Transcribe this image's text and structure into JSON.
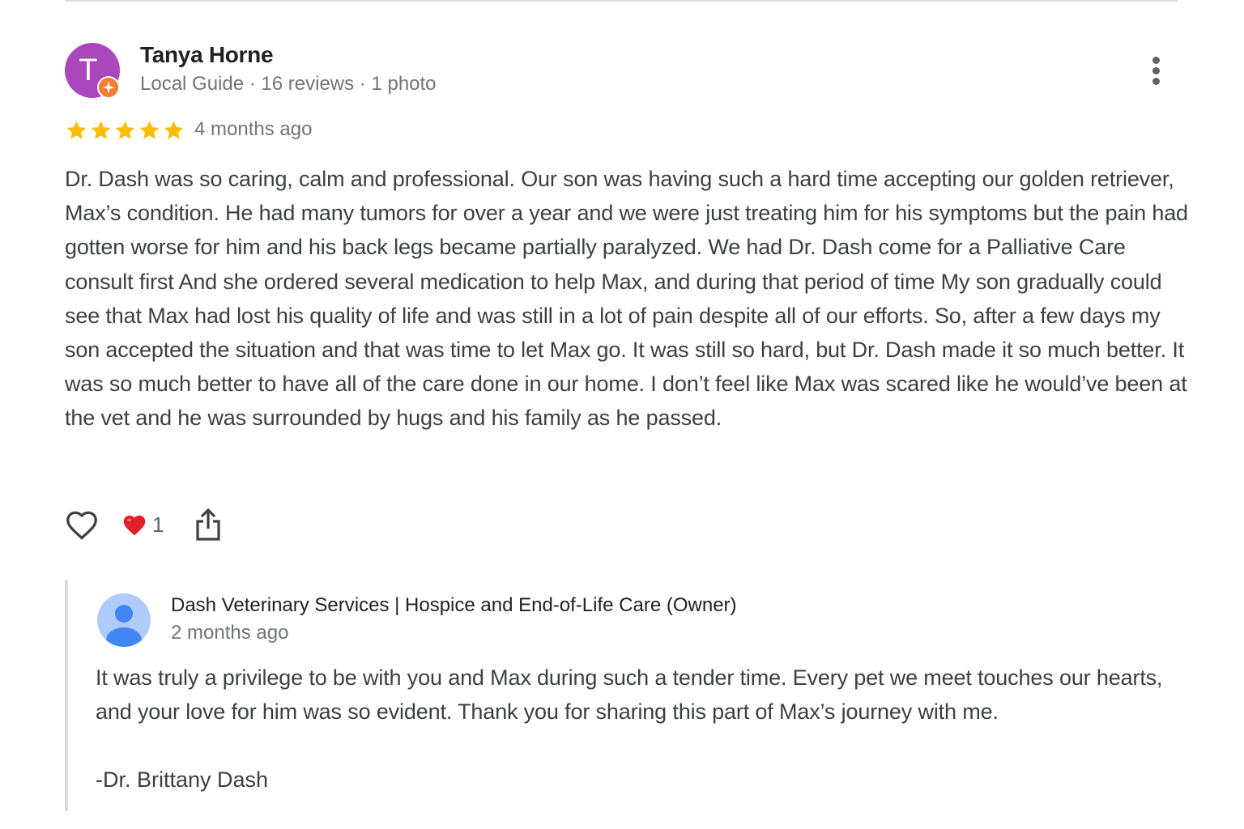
{
  "review": {
    "reviewer": {
      "name": "Tanya Horne",
      "avatar_letter": "T",
      "avatar_color": "#ab47bc",
      "badge_icon": "local-guide-badge-icon",
      "meta": "Local Guide · 16 reviews · 1 photo"
    },
    "more_icon": "more-vert-icon",
    "rating": {
      "stars": 5,
      "max": 5,
      "star_color": "#fbbc04"
    },
    "date": "4 months ago",
    "text": "Dr. Dash was so caring, calm and professional. Our son was having such a hard time accepting our golden retriever, Max’s condition. He had many tumors for over a year and we were just treating him for his symptoms but the pain had gotten worse for him and his back legs became partially paralyzed. We had Dr. Dash come for a Palliative Care consult first And she ordered several medication to help Max, and during that period of time My son gradually could see that Max had lost his quality of life and was still in a lot of pain despite all of our efforts. So, after a few days my son accepted the situation and that was time to let Max go. It was still so hard, but Dr. Dash made it so much better. It was so much better to have all of the care done in our home. I don’t feel like Max was scared like he would’ve been at the vet and he was surrounded by hugs and his family as he passed.",
    "actions": {
      "like_icon": "heart-outline-icon",
      "reaction_icon": "red-heart-icon",
      "reaction_count": "1",
      "share_icon": "share-icon"
    }
  },
  "owner_response": {
    "name": "Dash Veterinary Services | Hospice and End-of-Life Care (Owner)",
    "avatar_icon": "default-person-avatar-icon",
    "date": "2 months ago",
    "text": "It was truly a privilege to be with you and Max during such a tender time. Every pet we meet touches our hearts, and your love for him was so evident. Thank you for sharing this part of Max’s journey with me.",
    "signature": "-Dr. Brittany Dash"
  }
}
